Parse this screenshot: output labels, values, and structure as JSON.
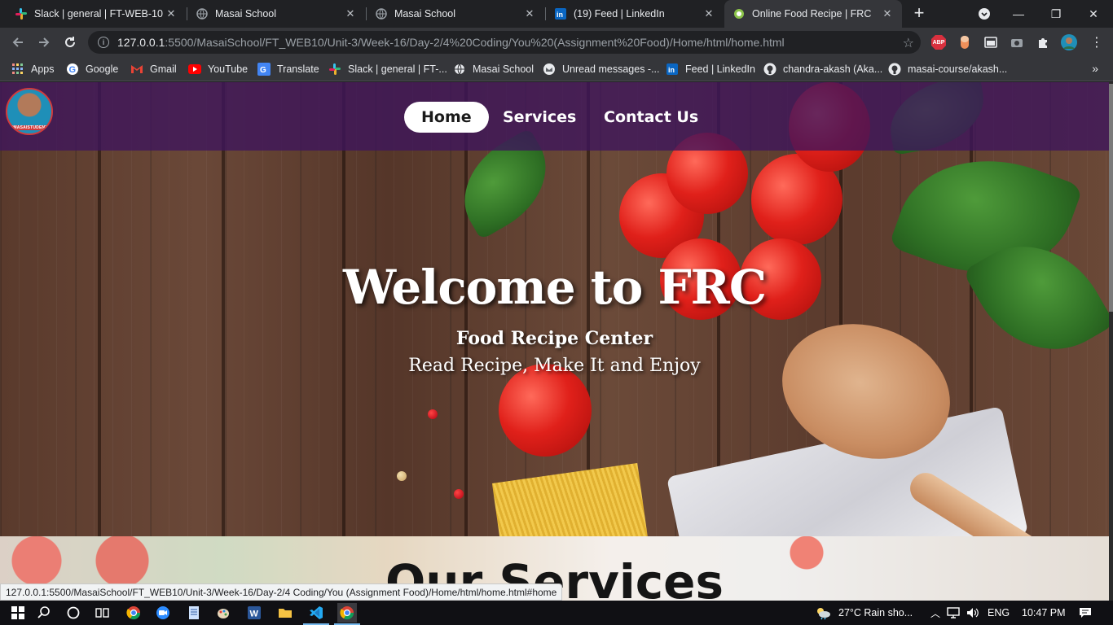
{
  "browser": {
    "tabs": [
      {
        "title": "Slack | general | FT-WEB-10",
        "icon": "slack-icon"
      },
      {
        "title": "Masai School",
        "icon": "globe-icon"
      },
      {
        "title": "Masai School",
        "icon": "globe-icon"
      },
      {
        "title": "(19) Feed | LinkedIn",
        "icon": "linkedin-icon"
      },
      {
        "title": "Online Food Recipe | FRC",
        "icon": "food-icon",
        "active": true
      }
    ],
    "url_host": "127.0.0.1",
    "url_path": ":5500/MasaiSchool/FT_WEB10/Unit-3/Week-16/Day-2/4%20Coding/You%20(Assignment%20Food)/Home/html/home.html",
    "bookmarks": [
      {
        "label": "Apps",
        "icon": "apps-grid-icon"
      },
      {
        "label": "Google",
        "icon": "google-icon"
      },
      {
        "label": "Gmail",
        "icon": "gmail-icon"
      },
      {
        "label": "YouTube",
        "icon": "youtube-icon"
      },
      {
        "label": "Translate",
        "icon": "translate-icon"
      },
      {
        "label": "Slack | general | FT-...",
        "icon": "slack-icon"
      },
      {
        "label": "Masai School",
        "icon": "globe-icon"
      },
      {
        "label": "Unread messages -...",
        "icon": "mail-icon"
      },
      {
        "label": "Feed | LinkedIn",
        "icon": "linkedin-icon"
      },
      {
        "label": "chandra-akash (Aka...",
        "icon": "github-icon"
      },
      {
        "label": "masai-course/akash...",
        "icon": "github-icon"
      }
    ],
    "ext_abp": "ABP",
    "status_url": "127.0.0.1:5500/MasaiSchool/FT_WEB10/Unit-3/Week-16/Day-2/4 Coding/You (Assignment Food)/Home/html/home.html#home"
  },
  "page": {
    "avatar_badge": "#MASAISTUDENT",
    "nav": [
      {
        "label": "Home",
        "active": true
      },
      {
        "label": "Services",
        "active": false
      },
      {
        "label": "Contact Us",
        "active": false
      }
    ],
    "hero": {
      "title": "Welcome to FRC",
      "subtitle": "Food Recipe Center",
      "tagline": "Read Recipe, Make It and Enjoy"
    },
    "services_title": "Our Services"
  },
  "taskbar": {
    "weather": "27°C  Rain sho...",
    "language": "ENG",
    "time": "10:47 PM"
  },
  "colors": {
    "navbar": "#3e145c",
    "active_nav_bg": "#ffffff"
  }
}
